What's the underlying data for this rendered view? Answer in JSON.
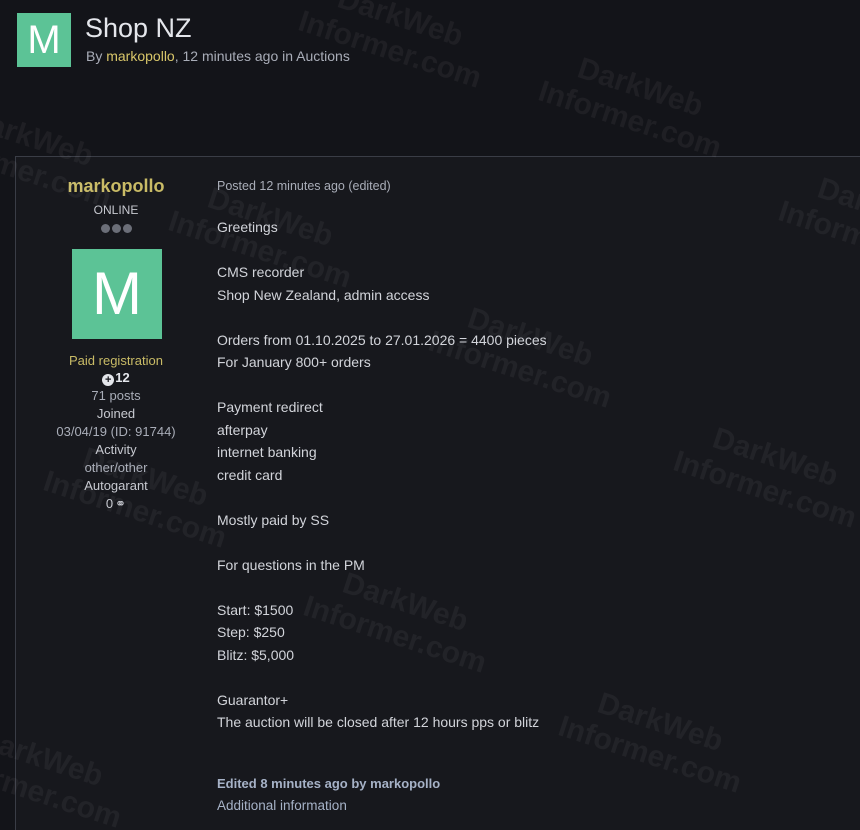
{
  "topic": {
    "avatar_letter": "M",
    "title": "Shop NZ",
    "by_prefix": "By ",
    "author": "markopollo",
    "time_text": ", 12 minutes ago in ",
    "forum": "Auctions"
  },
  "author_panel": {
    "name": "markopollo",
    "status": "ONLINE",
    "avatar_letter": "M",
    "group": "Paid registration",
    "reputation": "12",
    "posts": "71 posts",
    "joined_label": "Joined",
    "joined_value": "03/04/19 (ID: 91744)",
    "activity_label": "Activity",
    "activity_value": "other/other",
    "autogarant_label": "Autogarant",
    "autogarant_value": "0"
  },
  "post": {
    "meta": "Posted 12 minutes ago (edited)",
    "lines": [
      "Greetings",
      "",
      "CMS recorder",
      "Shop New Zealand, admin access",
      "",
      "Orders from 01.10.2025 to 27.01.2026 = 4400 pieces",
      "For January 800+ orders",
      "",
      "Payment redirect",
      "afterpay",
      "internet banking",
      "credit card",
      "",
      "Mostly paid by SS",
      "",
      "For questions in the PM",
      "",
      "Start: $1500",
      "Step: $250",
      "Blitz: $5,000",
      "",
      "Guarantor+",
      "The auction will be closed after 12 hours pps or blitz"
    ],
    "edited": "Edited 8 minutes ago by markopollo",
    "additional": "Additional information"
  },
  "watermark": {
    "line1": "DarkWeb",
    "line2": "Informer.com"
  },
  "colors": {
    "background": "#131419",
    "avatar": "#5cc396",
    "username": "#c9bb66"
  }
}
